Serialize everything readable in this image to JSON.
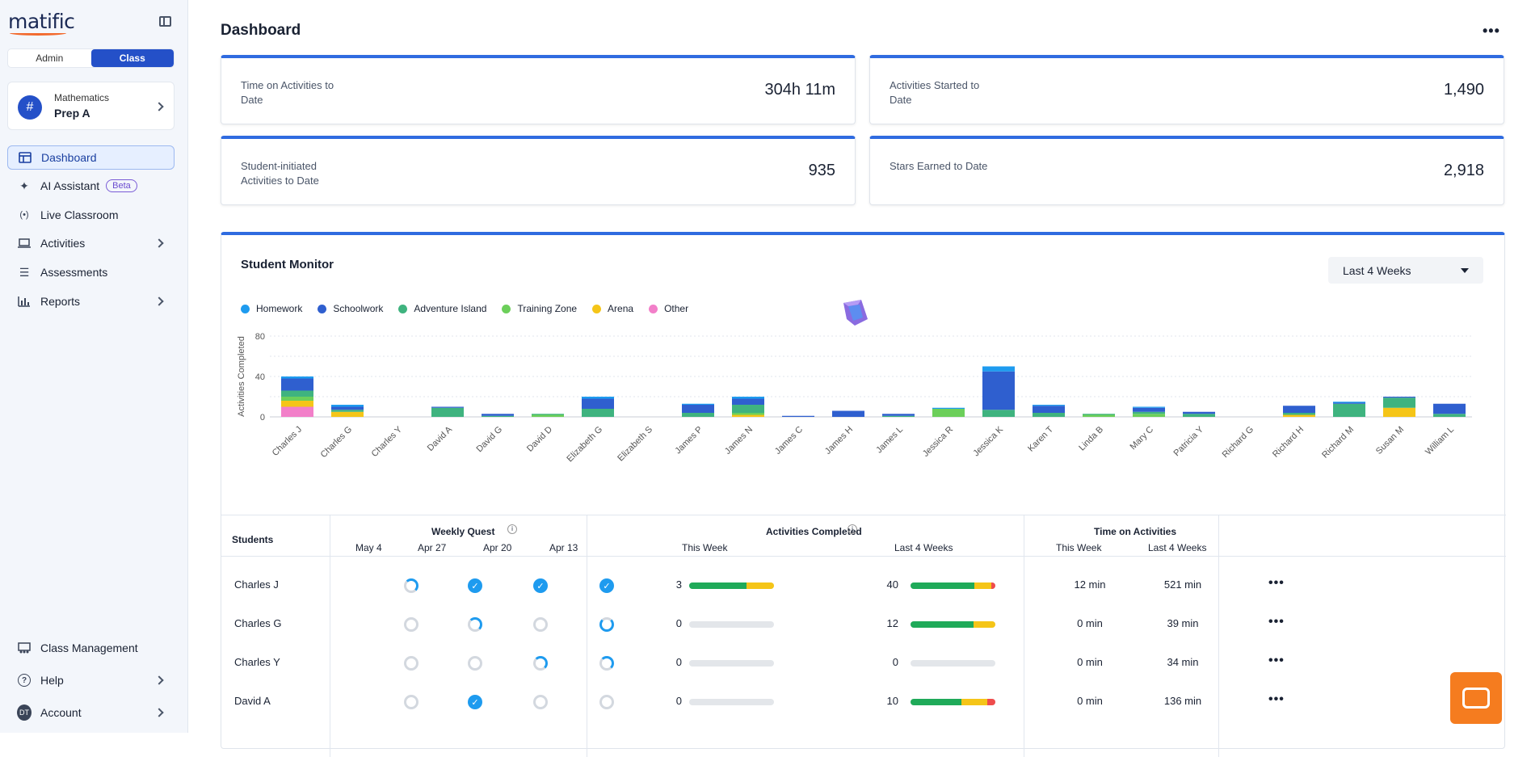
{
  "app": {
    "logo": "matific"
  },
  "sidebar": {
    "toggle": [
      "Admin",
      "Class"
    ],
    "class_card": {
      "subject": "Mathematics",
      "name": "Prep A",
      "avatar": "#"
    },
    "items": [
      {
        "label": "Dashboard",
        "icon": "dashboard-icon"
      },
      {
        "label": "AI Assistant",
        "icon": "sparkle-icon",
        "badge": "Beta"
      },
      {
        "label": "Live Classroom",
        "icon": "broadcast-icon"
      },
      {
        "label": "Activities",
        "icon": "laptop-icon"
      },
      {
        "label": "Assessments",
        "icon": "checklist-icon"
      },
      {
        "label": "Reports",
        "icon": "bar-chart-icon"
      }
    ],
    "bottom": [
      {
        "label": "Class Management",
        "icon": "class-icon"
      },
      {
        "label": "Help",
        "icon": "help-icon"
      },
      {
        "label": "Account",
        "icon": "account-avatar",
        "avatar": "DT"
      }
    ]
  },
  "header": {
    "title": "Dashboard",
    "more": "..."
  },
  "stats": [
    {
      "label": "Time on Activities to Date",
      "value": "304h 11m"
    },
    {
      "label": "Activities Started to Date",
      "value": "1,490"
    },
    {
      "label": "Student-initiated Activities to Date",
      "value": "935"
    },
    {
      "label": "Stars Earned to Date",
      "value": "2,918"
    }
  ],
  "monitor": {
    "title": "Student Monitor",
    "range": "Last 4 Weeks",
    "legend": [
      {
        "name": "Homework",
        "color": "#1e9bef"
      },
      {
        "name": "Schoolwork",
        "color": "#2f5fcf"
      },
      {
        "name": "Adventure Island",
        "color": "#3fb37f"
      },
      {
        "name": "Training Zone",
        "color": "#6ccf5a"
      },
      {
        "name": "Arena",
        "color": "#f5c518"
      },
      {
        "name": "Other",
        "color": "#f27fc9"
      }
    ]
  },
  "chart_data": {
    "type": "bar",
    "stacked": true,
    "ylabel": "Activities Completed",
    "ylim": [
      0,
      80
    ],
    "yticks": [
      0,
      40,
      80
    ],
    "categories": [
      "Charles J",
      "Charles G",
      "Charles Y",
      "David A",
      "David G",
      "David D",
      "Elizabeth G",
      "Elizabeth S",
      "James P",
      "James N",
      "James C",
      "James H",
      "James L",
      "Jessica R",
      "Jessica K",
      "Karen T",
      "Linda B",
      "Mary C",
      "Patricia Y",
      "Richard G",
      "Richard H",
      "Richard M",
      "Susan M",
      "William L"
    ],
    "series": [
      {
        "name": "Other",
        "values": [
          10,
          0,
          0,
          0,
          0,
          0,
          0,
          0,
          0,
          0,
          0,
          0,
          0,
          0,
          0,
          0,
          0,
          0,
          0,
          0,
          0,
          0,
          0,
          0
        ]
      },
      {
        "name": "Arena",
        "values": [
          6,
          5,
          0,
          0,
          0,
          0,
          0,
          0,
          0,
          2,
          0,
          0,
          0,
          0,
          0,
          0,
          0,
          0,
          0,
          0,
          2,
          0,
          9,
          0
        ]
      },
      {
        "name": "Training Zone",
        "values": [
          4,
          0,
          0,
          0,
          0,
          2,
          0,
          0,
          0,
          2,
          0,
          0,
          0,
          8,
          0,
          0,
          2,
          3,
          0,
          0,
          0,
          0,
          0,
          0
        ]
      },
      {
        "name": "Adventure Island",
        "values": [
          6,
          2,
          0,
          9,
          1,
          1,
          8,
          0,
          4,
          8,
          0,
          0,
          1,
          0,
          7,
          4,
          1,
          2,
          3,
          0,
          2,
          13,
          10,
          3
        ]
      },
      {
        "name": "Schoolwork",
        "values": [
          12,
          3,
          0,
          1,
          2,
          0,
          10,
          0,
          8,
          6,
          1,
          6,
          2,
          0,
          38,
          7,
          0,
          4,
          2,
          0,
          7,
          1,
          1,
          10
        ]
      },
      {
        "name": "Homework",
        "values": [
          2,
          2,
          0,
          0,
          0,
          0,
          2,
          0,
          1,
          2,
          0,
          0,
          0,
          1,
          5,
          1,
          0,
          1,
          0,
          0,
          0,
          1,
          0,
          0
        ]
      }
    ]
  },
  "table": {
    "headers": {
      "students": "Students",
      "weekly_quest": "Weekly Quest",
      "quest_weeks": [
        "May 4",
        "Apr 27",
        "Apr 20",
        "Apr 13"
      ],
      "activities": "Activities Completed",
      "time": "Time on Activities",
      "this_week": "This Week",
      "last4": "Last 4 Weeks"
    },
    "rows": [
      {
        "name": "Charles J",
        "quest": [
          "partial",
          "done",
          "done",
          "done"
        ],
        "act_week": "3",
        "act_week_segs": [
          [
            0.68,
            "#1faa59"
          ],
          [
            0.32,
            "#f5c518"
          ]
        ],
        "act_4w": "40",
        "act_4w_segs": [
          [
            0.75,
            "#1faa59"
          ],
          [
            0.2,
            "#f5c518"
          ],
          [
            0.05,
            "#ef4c4c"
          ]
        ],
        "time_week": "12 min",
        "time_4w": "521 min"
      },
      {
        "name": "Charles G",
        "quest": [
          "empty",
          "partial",
          "empty",
          "mostly"
        ],
        "act_week": "0",
        "act_week_segs": [],
        "act_4w": "12",
        "act_4w_segs": [
          [
            0.74,
            "#1faa59"
          ],
          [
            0.26,
            "#f5c518"
          ]
        ],
        "time_week": "0 min",
        "time_4w": "39 min"
      },
      {
        "name": "Charles Y",
        "quest": [
          "empty",
          "empty",
          "partial",
          "partial"
        ],
        "act_week": "0",
        "act_week_segs": [],
        "act_4w": "0",
        "act_4w_segs": [],
        "time_week": "0 min",
        "time_4w": "34 min"
      },
      {
        "name": "David A",
        "quest": [
          "empty",
          "done",
          "empty",
          "empty"
        ],
        "act_week": "0",
        "act_week_segs": [],
        "act_4w": "10",
        "act_4w_segs": [
          [
            0.6,
            "#1faa59"
          ],
          [
            0.3,
            "#f5c518"
          ],
          [
            0.1,
            "#ef4c4c"
          ]
        ],
        "time_week": "0 min",
        "time_4w": "136 min"
      }
    ]
  }
}
